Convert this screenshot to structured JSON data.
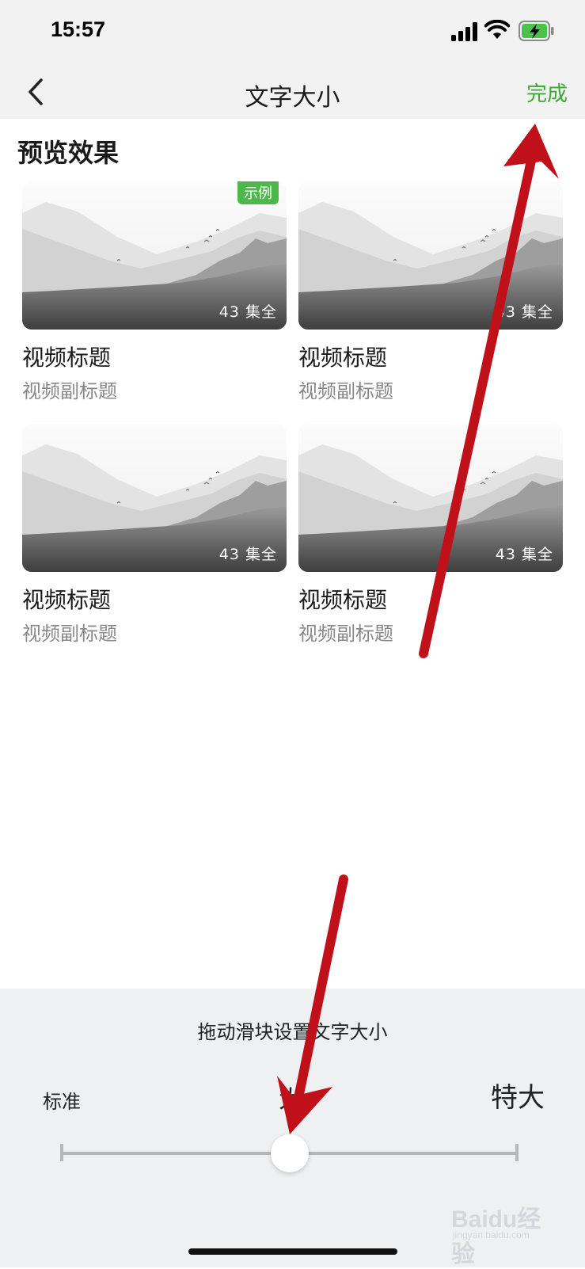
{
  "status_bar": {
    "time": "15:57"
  },
  "nav": {
    "title": "文字大小",
    "done_label": "完成"
  },
  "preview": {
    "heading": "预览效果",
    "sample_badge": "示例",
    "cards": [
      {
        "title": "视频标题",
        "subtitle": "视频副标题",
        "episodes": "43 集全"
      },
      {
        "title": "视频标题",
        "subtitle": "视频副标题",
        "episodes": "43 集全"
      },
      {
        "title": "视频标题",
        "subtitle": "视频副标题",
        "episodes": "43 集全"
      },
      {
        "title": "视频标题",
        "subtitle": "视频副标题",
        "episodes": "43 集全"
      }
    ]
  },
  "font_slider": {
    "hint": "拖动滑块设置文字大小",
    "labels": [
      "标准",
      "大",
      "特大"
    ],
    "selected": "大",
    "selected_index": 1,
    "stops": 3
  },
  "watermark": {
    "text": "Baidu经验",
    "sub": "jingyan.baidu.com"
  },
  "colors": {
    "accent_green": "#3aaa35",
    "annotation_arrow": "#c0111a",
    "panel_bg": "#eef0f2"
  }
}
